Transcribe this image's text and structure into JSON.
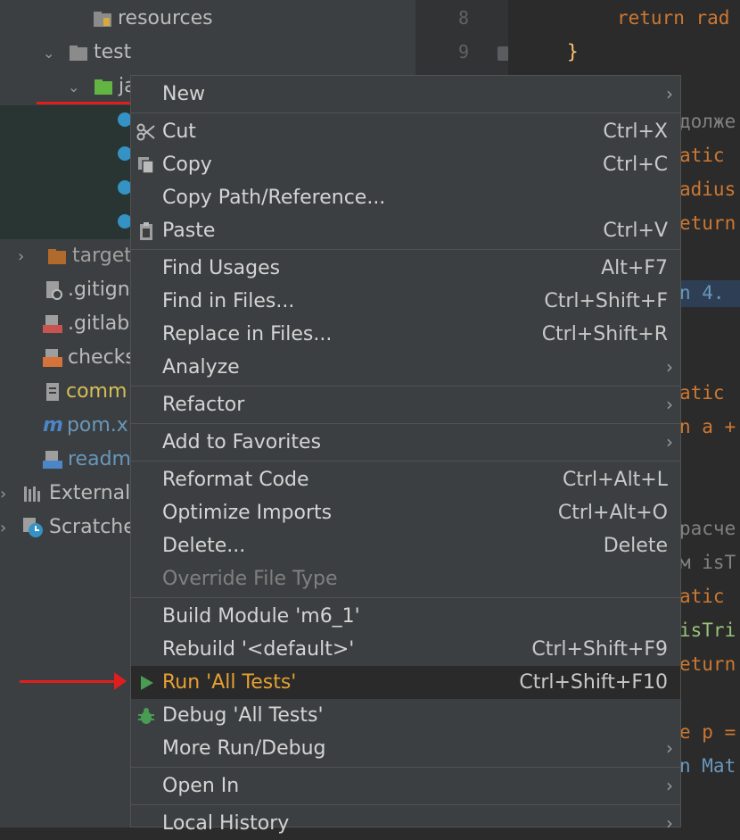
{
  "tree": {
    "items": [
      {
        "label": "resources",
        "icon": "resources-folder-icon"
      },
      {
        "label": "test",
        "icon": "folder-icon"
      },
      {
        "label": "ja",
        "icon": "java-folder-icon"
      },
      {
        "label": "target",
        "icon": "target-folder-icon"
      },
      {
        "label": ".gitign",
        "icon": "gitignore-icon"
      },
      {
        "label": ".gitlab",
        "icon": "yml-file-icon"
      },
      {
        "label": "checks",
        "icon": "xml-file-icon"
      },
      {
        "label": "comm",
        "icon": "text-file-icon"
      },
      {
        "label": "pom.x",
        "icon": "maven-icon"
      },
      {
        "label": "readm",
        "icon": "markdown-icon"
      },
      {
        "label": "External",
        "icon": "library-icon"
      },
      {
        "label": "Scratche",
        "icon": "scratches-icon"
      }
    ]
  },
  "editor": {
    "line_numbers": [
      "8",
      "9"
    ],
    "fragments": [
      "return rad",
      "}",
      "долже",
      "atic",
      "adius",
      "eturn",
      "n 4.",
      "atic",
      "n a +",
      "расче",
      "м isT",
      "atic",
      "isTri",
      "eturn",
      "e p =",
      "n Mat"
    ]
  },
  "menu": {
    "items": [
      {
        "label": "New",
        "shortcut": "",
        "submenu": "›"
      },
      {
        "label": "Cut",
        "shortcut": "Ctrl+X",
        "icon": "scissors-icon"
      },
      {
        "label": "Copy",
        "shortcut": "Ctrl+C",
        "icon": "copy-icon"
      },
      {
        "label": "Copy Path/Reference...",
        "shortcut": ""
      },
      {
        "label": "Paste",
        "shortcut": "Ctrl+V",
        "icon": "clipboard-icon"
      },
      {
        "label": "Find Usages",
        "shortcut": "Alt+F7"
      },
      {
        "label": "Find in Files...",
        "shortcut": "Ctrl+Shift+F"
      },
      {
        "label": "Replace in Files...",
        "shortcut": "Ctrl+Shift+R"
      },
      {
        "label": "Analyze",
        "shortcut": "",
        "submenu": "›"
      },
      {
        "label": "Refactor",
        "shortcut": "",
        "submenu": "›"
      },
      {
        "label": "Add to Favorites",
        "shortcut": "",
        "submenu": "›"
      },
      {
        "label": "Reformat Code",
        "shortcut": "Ctrl+Alt+L"
      },
      {
        "label": "Optimize Imports",
        "shortcut": "Ctrl+Alt+O"
      },
      {
        "label": "Delete...",
        "shortcut": "Delete"
      },
      {
        "label": "Override File Type",
        "shortcut": ""
      },
      {
        "label": "Build Module 'm6_1'",
        "shortcut": ""
      },
      {
        "label": "Rebuild '<default>'",
        "shortcut": "Ctrl+Shift+F9"
      },
      {
        "label": "Run 'All Tests'",
        "shortcut": "Ctrl+Shift+F10",
        "icon": "run-icon"
      },
      {
        "label": "Debug 'All Tests'",
        "shortcut": "",
        "icon": "bug-icon"
      },
      {
        "label": "More Run/Debug",
        "shortcut": "",
        "submenu": "›"
      },
      {
        "label": "Open In",
        "shortcut": "",
        "submenu": "›"
      },
      {
        "label": "Local History",
        "shortcut": "",
        "submenu": "›"
      }
    ]
  },
  "colors": {
    "highlight_text": "#e6a033",
    "annotation_red": "#e01e1e",
    "run_green": "#499c54"
  }
}
